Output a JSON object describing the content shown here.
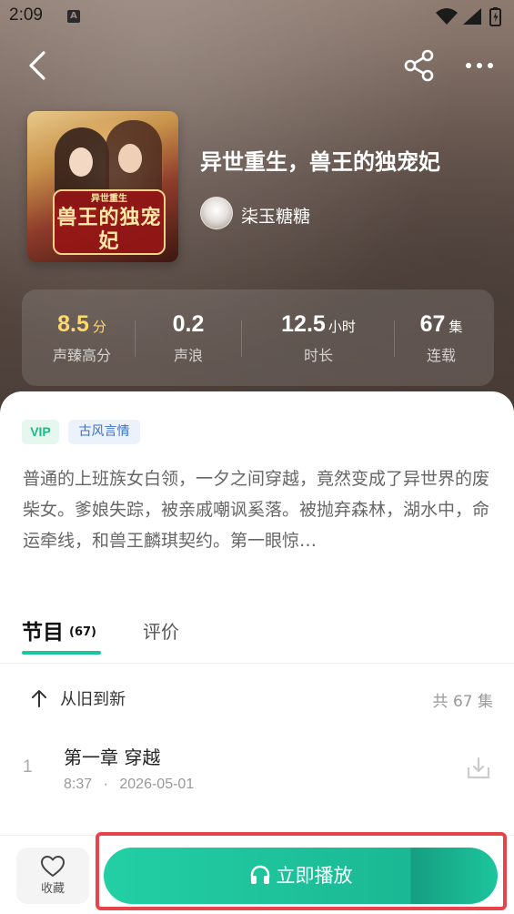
{
  "status_bar": {
    "time": "2:09",
    "notification_icon": "A",
    "icons": [
      "wifi-icon",
      "signal-icon",
      "battery-icon"
    ]
  },
  "nav": {
    "icons": [
      "back-icon",
      "share-icon",
      "more-icon"
    ]
  },
  "book": {
    "title": "异世重生，兽王的独宠妃",
    "author": "柒玉糖糖",
    "cover_text_small": "异世重生",
    "cover_text_main": "兽王的独宠妃"
  },
  "stats": [
    {
      "value": "8.5",
      "unit": "分",
      "label": "声臻高分",
      "highlight": "#ffd86b"
    },
    {
      "value": "0.2",
      "unit": "",
      "label": "声浪"
    },
    {
      "value": "12.5",
      "unit": "小时",
      "label": "时长"
    },
    {
      "value": "67",
      "unit": "集",
      "label": "连载"
    }
  ],
  "tags": {
    "vip": "VIP",
    "genre": "古风言情"
  },
  "description": "普通的上班族女白领，一夕之间穿越，竟然变成了异世界的废柴女。爹娘失踪，被亲戚嘲讽奚落。被抛弃森林，湖水中，命运牵线，和兽王麟琪契约。第一眼惊…",
  "tabs": {
    "programs_label": "节目",
    "programs_count": "(67)",
    "reviews_label": "评价"
  },
  "episode_list": {
    "sort_label": "从旧到新",
    "total": "共 67 集",
    "episodes": [
      {
        "index": "1",
        "title": "第一章 穿越",
        "duration": "8:37",
        "separator": "·",
        "date": "2026-05-01"
      }
    ]
  },
  "bottom_bar": {
    "favorite_label": "收藏",
    "play_label": "立即播放"
  },
  "colors": {
    "accent": "#1cc59c",
    "highlight_border": "#e8424b",
    "rating": "#ffd86b"
  }
}
